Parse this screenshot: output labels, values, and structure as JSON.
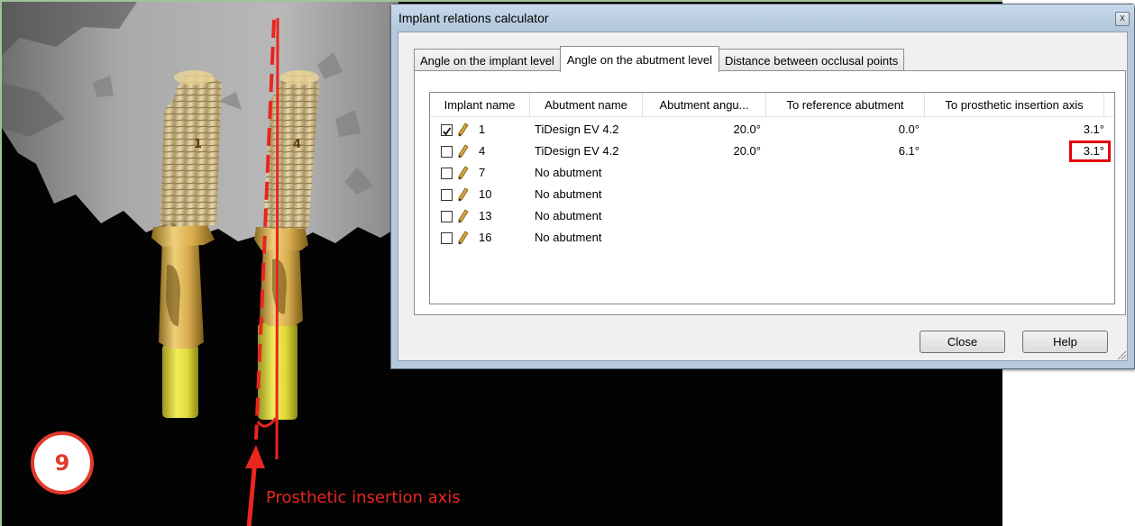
{
  "dialog": {
    "title": "Implant relations calculator",
    "close_glyph": "x",
    "tabs": [
      {
        "label": "Angle on the implant level",
        "active": false
      },
      {
        "label": "Angle on the abutment level",
        "active": true
      },
      {
        "label": "Distance between occlusal points",
        "active": false
      }
    ],
    "columns": [
      "Implant name",
      "Abutment name",
      "Abutment angu...",
      "To reference abutment",
      "To prosthetic insertion axis"
    ],
    "rows": [
      {
        "checked": true,
        "implant": "1",
        "abutment": "TiDesign EV 4.2",
        "angulation": "20.0°",
        "to_reference": "0.0°",
        "to_prosthetic": "3.1°",
        "highlighted": false
      },
      {
        "checked": false,
        "implant": "4",
        "abutment": "TiDesign EV 4.2",
        "angulation": "20.0°",
        "to_reference": "6.1°",
        "to_prosthetic": "3.1°",
        "highlighted": true
      },
      {
        "checked": false,
        "implant": "7",
        "abutment": "No abutment",
        "angulation": "",
        "to_reference": "",
        "to_prosthetic": "",
        "highlighted": false
      },
      {
        "checked": false,
        "implant": "10",
        "abutment": "No abutment",
        "angulation": "",
        "to_reference": "",
        "to_prosthetic": "",
        "highlighted": false
      },
      {
        "checked": false,
        "implant": "13",
        "abutment": "No abutment",
        "angulation": "",
        "to_reference": "",
        "to_prosthetic": "",
        "highlighted": false
      },
      {
        "checked": false,
        "implant": "16",
        "abutment": "No abutment",
        "angulation": "",
        "to_reference": "",
        "to_prosthetic": "",
        "highlighted": false
      }
    ],
    "buttons": {
      "close": "Close",
      "help": "Help"
    }
  },
  "viewport": {
    "implant_labels": [
      "1",
      "4"
    ],
    "axis_label": "Prosthetic insertion axis",
    "step_badge": "9"
  },
  "colors": {
    "annotation_red": "#e8261f",
    "badge_red": "#e23a2c",
    "implant_gold": "#d9b45a",
    "cylinder_yellow": "#e6e03c",
    "dialog_frame": "#b6c9dc"
  }
}
